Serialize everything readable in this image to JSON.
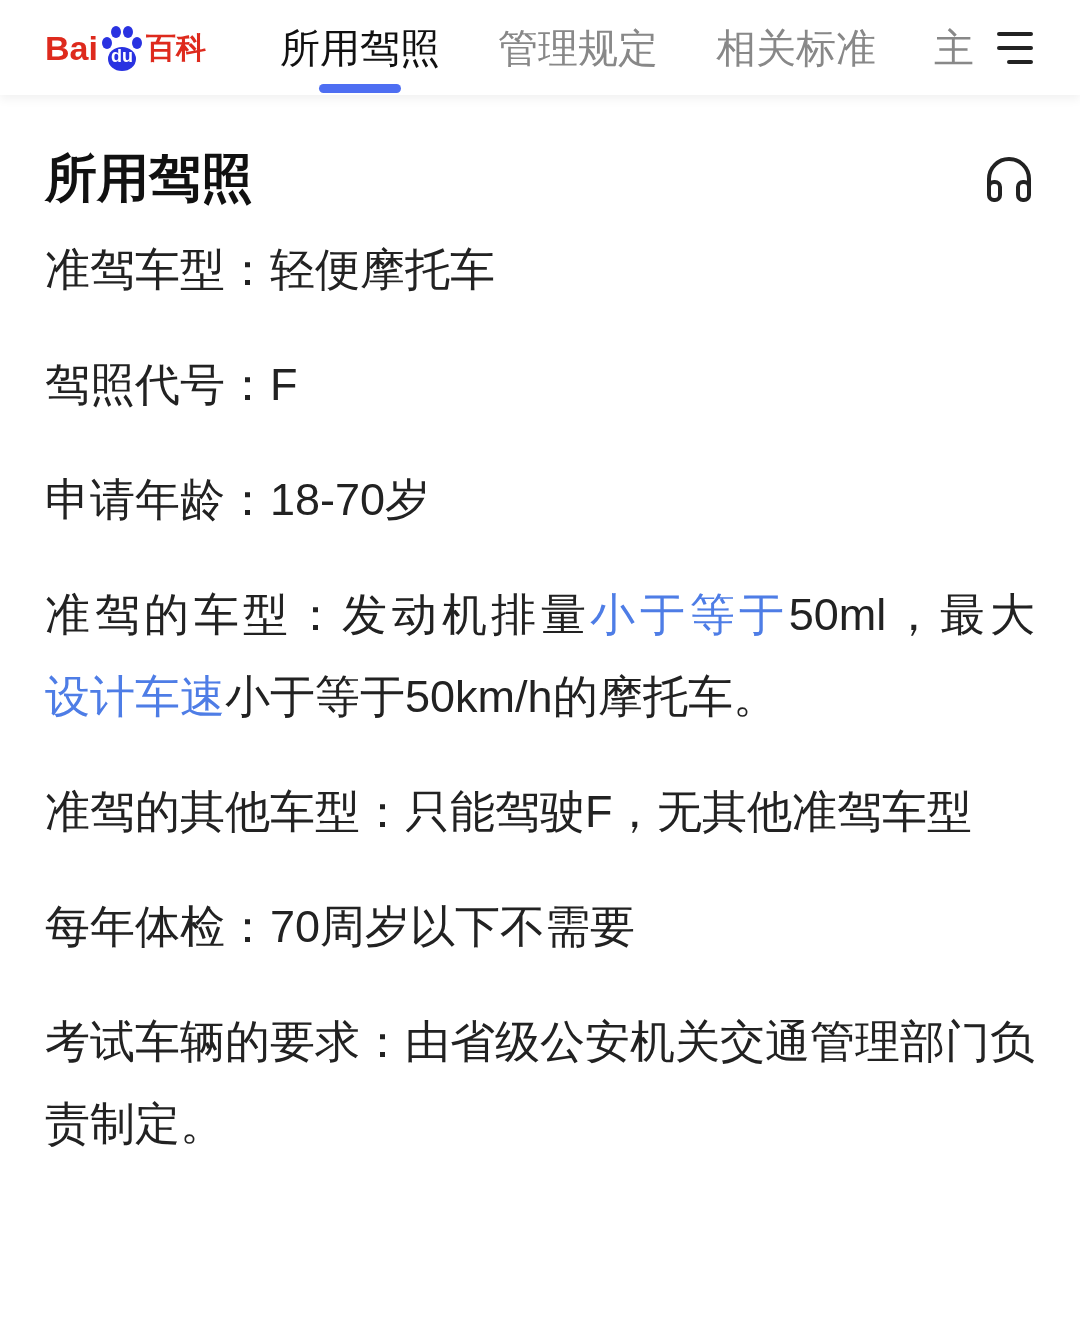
{
  "header": {
    "logo": {
      "left": "Bai",
      "paw": "du",
      "right": "百科"
    },
    "tabs": [
      {
        "label": "所用驾照",
        "selected": true
      },
      {
        "label": "管理规定",
        "selected": false
      },
      {
        "label": "相关标准",
        "selected": false
      },
      {
        "label": "主",
        "selected": false
      }
    ]
  },
  "section": {
    "title": "所用驾照",
    "paragraphs": [
      [
        {
          "text": "准驾车型：轻便摩托车",
          "kind": "plain"
        }
      ],
      [
        {
          "text": "驾照代号：F",
          "kind": "plain"
        }
      ],
      [
        {
          "text": "申请年龄：18-70岁",
          "kind": "plain"
        }
      ],
      [
        {
          "text": "准驾的车型：发动机排量",
          "kind": "plain"
        },
        {
          "text": "小于等于",
          "kind": "link"
        },
        {
          "text": "50ml，最大",
          "kind": "plain"
        },
        {
          "text": "设计车速",
          "kind": "link"
        },
        {
          "text": "小于等于50km/h的摩托车。",
          "kind": "plain"
        }
      ],
      [
        {
          "text": "准驾的其他车型：只能驾驶F，无其他准驾车型",
          "kind": "plain"
        }
      ],
      [
        {
          "text": "每年体检：70周岁以下不需要",
          "kind": "plain"
        }
      ],
      [
        {
          "text": "考试车辆的要求：由省级公安机关交通管理部门负责制定。",
          "kind": "plain"
        }
      ]
    ]
  }
}
